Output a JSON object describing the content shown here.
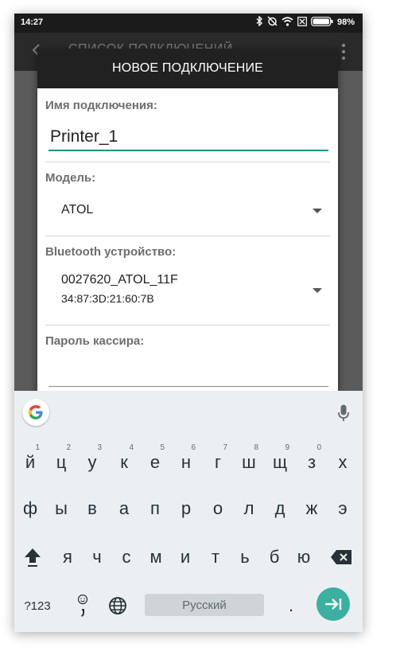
{
  "statusbar": {
    "time": "14:27",
    "battery": "98%"
  },
  "background_toolbar": {
    "title": "СПИСОК ПОДКЛЮЧЕНИЙ"
  },
  "dialog": {
    "title": "НОВОЕ ПОДКЛЮЧЕНИЕ",
    "connection_name_label": "Имя подключения:",
    "connection_name_value": "Printer_1",
    "model_label": "Модель:",
    "model_value": "ATOL",
    "bluetooth_label": "Bluetooth устройство:",
    "bluetooth_device_name": "0027620_ATOL_11F",
    "bluetooth_device_address": "34:87:3D:21:60:7B",
    "password_label": "Пароль кассира:",
    "password_value": ""
  },
  "keyboard": {
    "row1": [
      {
        "k": "й",
        "h": "1"
      },
      {
        "k": "ц",
        "h": "2"
      },
      {
        "k": "у",
        "h": "3"
      },
      {
        "k": "к",
        "h": "4"
      },
      {
        "k": "е",
        "h": "5"
      },
      {
        "k": "н",
        "h": "6"
      },
      {
        "k": "г",
        "h": "7"
      },
      {
        "k": "ш",
        "h": "8"
      },
      {
        "k": "щ",
        "h": "9"
      },
      {
        "k": "з",
        "h": "0"
      },
      {
        "k": "х",
        "h": ""
      }
    ],
    "row2": [
      "ф",
      "ы",
      "в",
      "а",
      "п",
      "р",
      "о",
      "л",
      "д",
      "ж",
      "э"
    ],
    "row3": [
      "я",
      "ч",
      "с",
      "м",
      "и",
      "т",
      "ь",
      "б",
      "ю"
    ],
    "symbols_label": "?123",
    "space_label": "Русский",
    "period_label": ".",
    "accent_color": "#3bb0a0"
  }
}
